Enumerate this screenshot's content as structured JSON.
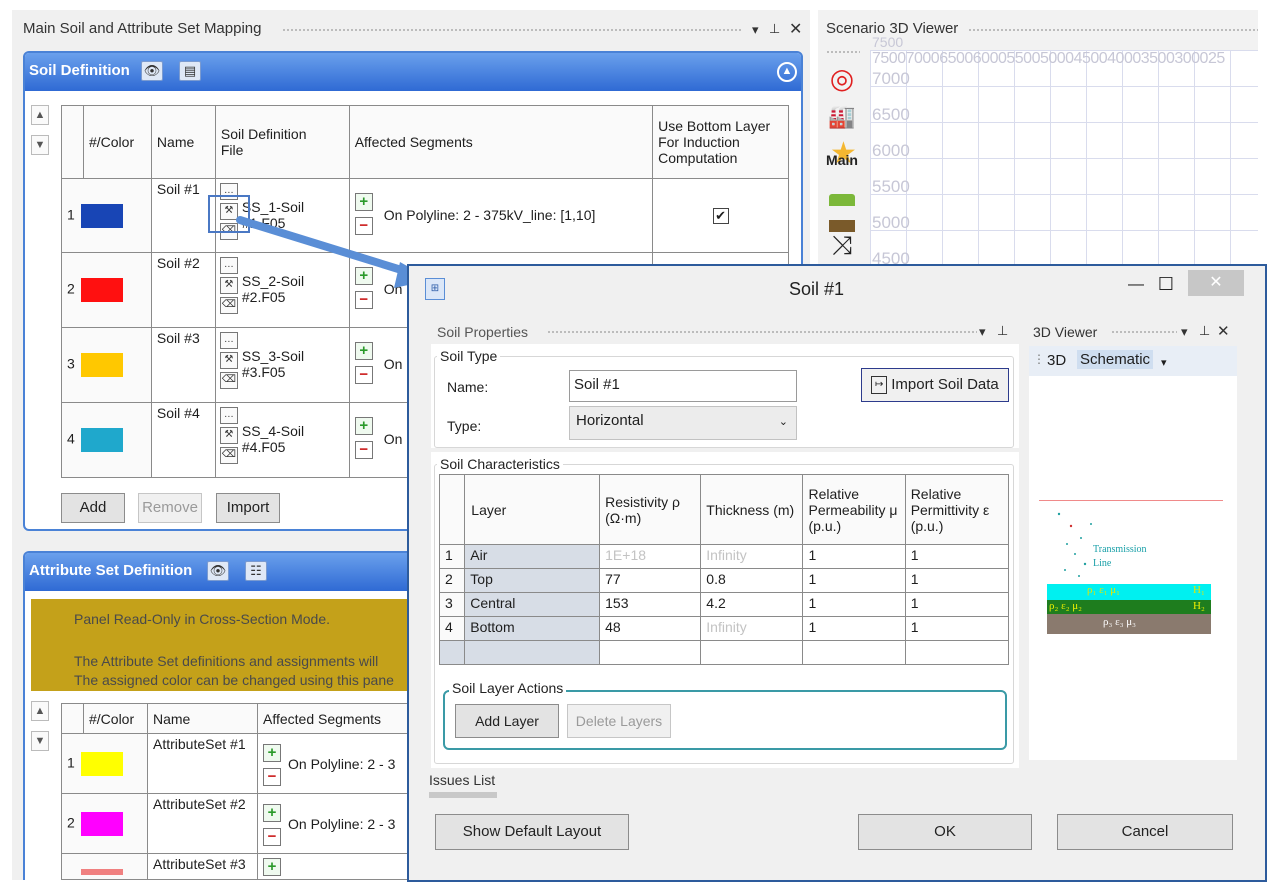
{
  "main_panel": {
    "title": "Main Soil and Attribute Set Mapping",
    "soil_definition": {
      "title": "Soil Definition",
      "columns": [
        "#/Color",
        "Name",
        "Soil Definition\nFile",
        "Affected Segments",
        "Use Bottom Layer For Induction Computation"
      ],
      "rows": [
        {
          "num": "1",
          "color": "#1845b5",
          "name": "Soil #1",
          "file": "SS_1-Soil #1.F05",
          "segment": "On Polyline: 2 - 375kV_line: [1,10]",
          "checked": true
        },
        {
          "num": "2",
          "color": "#ff1010",
          "name": "Soil #2",
          "file": "SS_2-Soil #2.F05",
          "segment": "On P",
          "checked": false
        },
        {
          "num": "3",
          "color": "#ffc800",
          "name": "Soil #3",
          "file": "SS_3-Soil #3.F05",
          "segment": "On P",
          "checked": false
        },
        {
          "num": "4",
          "color": "#1fa8cc",
          "name": "Soil #4",
          "file": "SS_4-Soil #4.F05",
          "segment": "On P",
          "checked": false
        }
      ],
      "buttons": {
        "add": "Add",
        "remove": "Remove",
        "import": "Import"
      }
    },
    "attribute_set": {
      "title": "Attribute Set Definition",
      "notice_line1": "Panel Read-Only in Cross-Section Mode.",
      "notice_line2": "The Attribute Set definitions and assignments will",
      "notice_line3": "The assigned color can be changed using this pane",
      "columns": [
        "#/Color",
        "Name",
        "Affected Segments"
      ],
      "rows": [
        {
          "num": "1",
          "color": "#ffff00",
          "name": "AttributeSet #1",
          "segment": "On Polyline: 2 - 3"
        },
        {
          "num": "2",
          "color": "#ff00ff",
          "name": "AttributeSet #2",
          "segment": "On Polyline: 2 - 3"
        },
        {
          "num": "3",
          "color": "#f08080",
          "name": "AttributeSet #3",
          "segment": ""
        }
      ]
    }
  },
  "scenario_viewer": {
    "title": "Scenario 3D Viewer",
    "y_ticks": [
      "7000",
      "6500",
      "6000",
      "5500",
      "5000",
      "4500"
    ],
    "top_tick": "7500",
    "x_ticks_text": "750070006500600055005000450040003500300025",
    "side_icons": [
      {
        "icon": "target-icon",
        "glyph": "◎",
        "color": "#e02020"
      },
      {
        "icon": "factory-icon",
        "glyph": "▟",
        "color": "#222222"
      },
      {
        "icon": "main-star-icon",
        "glyph": "Main",
        "color": "#222222"
      },
      {
        "icon": "soil-cube-icon",
        "glyph": "■",
        "color": "#6f9a2a"
      },
      {
        "icon": "shuffle-icon",
        "glyph": "⤨",
        "color": "#222222"
      }
    ]
  },
  "dialog": {
    "title": "Soil #1",
    "soil_properties": {
      "title": "Soil Properties",
      "soil_type_legend": "Soil Type",
      "name_label": "Name:",
      "name_value": "Soil #1",
      "type_label": "Type:",
      "type_value": "Horizontal",
      "import_button": "Import Soil Data",
      "characteristics_legend": "Soil Characteristics",
      "columns": [
        "Layer",
        "Resistivity ρ (Ω·m)",
        "Thickness (m)",
        "Relative Permeability μ (p.u.)",
        "Relative Permittivity ε (p.u.)"
      ],
      "rows": [
        {
          "num": "1",
          "layer": "Air",
          "resistivity": "1E+18",
          "thickness": "Infinity",
          "permeability": "1",
          "permittivity": "1"
        },
        {
          "num": "2",
          "layer": "Top",
          "resistivity": "77",
          "thickness": "0.8",
          "permeability": "1",
          "permittivity": "1"
        },
        {
          "num": "3",
          "layer": "Central",
          "resistivity": "153",
          "thickness": "4.2",
          "permeability": "1",
          "permittivity": "1"
        },
        {
          "num": "4",
          "layer": "Bottom",
          "resistivity": "48",
          "thickness": "Infinity",
          "permeability": "1",
          "permittivity": "1"
        }
      ],
      "layer_actions_legend": "Soil Layer Actions",
      "add_layer": "Add Layer",
      "delete_layers": "Delete Layers"
    },
    "viewer_3d": {
      "title": "3D Viewer",
      "tab_3d": "3D",
      "tab_schematic": "Schematic",
      "transmission_label_1": "Transmission",
      "transmission_label_2": "Line",
      "layer1_params": "ρ₁ ε₁ μ₁",
      "layer1_h": "H₁",
      "layer2_params": "ρ₂ ε₂ μ₂",
      "layer2_h": "H₂",
      "layer3_params": "ρ₃ ε₃ μ₃"
    },
    "issues_list": "Issues List",
    "buttons": {
      "show_default_layout": "Show Default Layout",
      "ok": "OK",
      "cancel": "Cancel"
    }
  }
}
